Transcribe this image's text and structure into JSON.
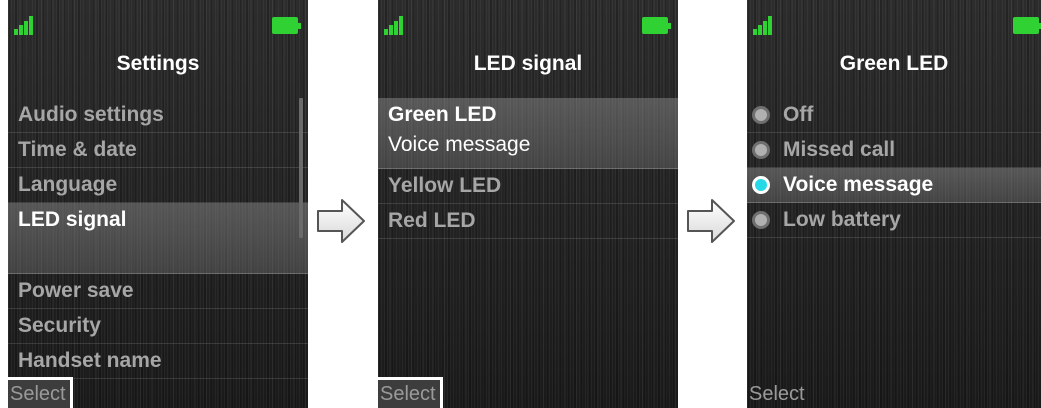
{
  "colors": {
    "signal": "#2fd133",
    "battery": "#2fd133",
    "radio_selected": "#25d9e6",
    "radio_unselected": "#b0b0b0"
  },
  "icons": {
    "signal": "signal-strength-icon",
    "battery": "battery-full-icon",
    "arrow": "arrow-right-icon",
    "radio_on": "radio-selected-icon",
    "radio_off": "radio-unselected-icon"
  },
  "screen1": {
    "title": "Settings",
    "items": [
      "Audio settings",
      "Time & date",
      "Language",
      "LED signal",
      "Power save",
      "Security",
      "Handset name"
    ],
    "selected_index": 3,
    "softkey": "Select"
  },
  "screen2": {
    "title": "LED signal",
    "items": [
      {
        "label": "Green LED",
        "value": "Voice message"
      },
      {
        "label": "Yellow LED"
      },
      {
        "label": "Red LED"
      }
    ],
    "selected_index": 0,
    "softkey": "Select"
  },
  "screen3": {
    "title": "Green LED",
    "options": [
      "Off",
      "Missed call",
      "Voice message",
      "Low battery"
    ],
    "selected_index": 2,
    "softkey": "Select"
  }
}
